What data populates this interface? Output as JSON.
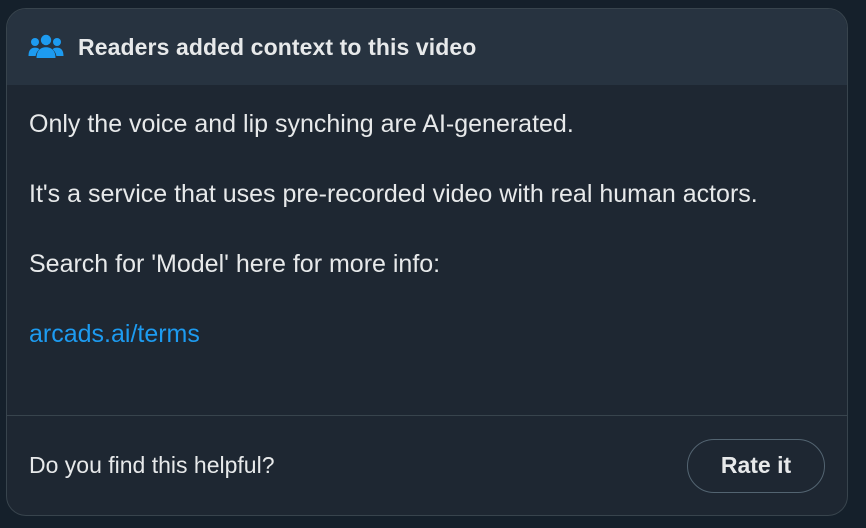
{
  "header": {
    "icon": "people-icon",
    "title": "Readers added context to this video"
  },
  "note": {
    "line1": "Only the voice and lip synching are AI-generated.",
    "line2": "It's a service that uses pre-recorded video with real human actors.",
    "line3": "Search for 'Model' here for more info:",
    "link_text": "arcads.ai/terms"
  },
  "footer": {
    "question": "Do you find this helpful?",
    "rate_label": "Rate it"
  },
  "colors": {
    "accent": "#1d9bf0",
    "background": "#15202b",
    "card": "#1e2732",
    "header": "#273340",
    "text": "#e7e9ea"
  }
}
